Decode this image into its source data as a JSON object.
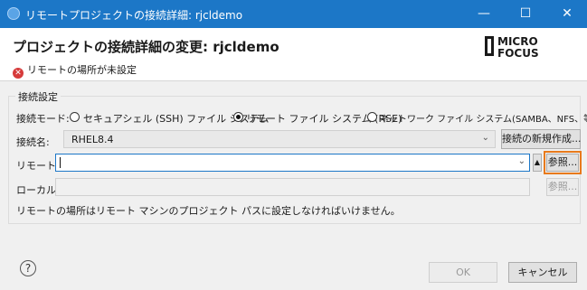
{
  "window": {
    "title": "リモートプロジェクトの接続詳細: rjcldemo",
    "minimize": "—",
    "maximize": "☐",
    "close": "✕"
  },
  "header": {
    "title": "プロジェクトの接続詳細の変更: rjcldemo",
    "error": "リモートの場所が未設定",
    "logo_line1": "MICRO",
    "logo_line2": "FOCUS"
  },
  "group": {
    "label": "接続設定"
  },
  "mode": {
    "label": "接続モード:",
    "options": [
      {
        "label": "セキュアシェル (SSH) ファイル システム",
        "selected": false
      },
      {
        "label": "リモート ファイル システム (RSE)",
        "selected": true
      },
      {
        "label": "ネットワーク ファイル システム(SAMBA、NFS、等...)",
        "selected": false
      }
    ]
  },
  "connection": {
    "label": "接続名:",
    "value": "RHEL8.4",
    "new_button": "接続の新規作成..."
  },
  "remote": {
    "label": "リモートの",
    "value": "",
    "browse_button": "参照..."
  },
  "local": {
    "label": "ローカル(",
    "value": "",
    "browse_button": "参照..."
  },
  "info_text": "リモートの場所はリモート マシンのプロジェクト パスに設定しなければいけません。",
  "footer": {
    "help": "?",
    "ok": "OK",
    "cancel": "キャンセル"
  },
  "colors": {
    "titlebar": "#1c77c7",
    "highlight": "#e87a1c",
    "error": "#d63b3b"
  }
}
